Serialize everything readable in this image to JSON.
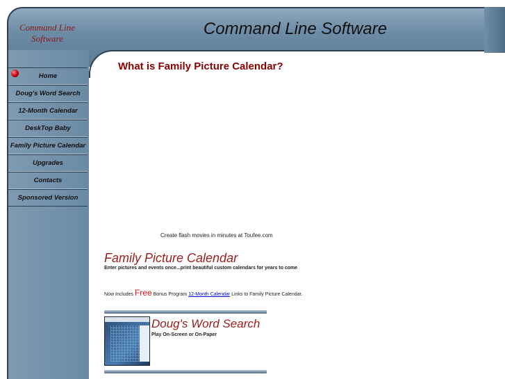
{
  "header": {
    "logo_line1": "Command Line",
    "logo_line2": "Software",
    "title": "Command Line Software"
  },
  "nav": {
    "items": [
      {
        "label": "Home"
      },
      {
        "label": "Doug's Word Search"
      },
      {
        "label": "12-Month Calendar"
      },
      {
        "label": "DeskTop Baby"
      },
      {
        "label": "Family Picture Calendar"
      },
      {
        "label": "Upgrades"
      },
      {
        "label": "Contacts"
      },
      {
        "label": "Sponsored Version"
      }
    ]
  },
  "main": {
    "heading": "What is  Family Picture Calendar?",
    "flash_caption": "Create flash movies in minutes at Toufee.com",
    "fpc_title": "Family Picture Calendar",
    "fpc_subtitle": "Enter pictures and events once...print beautiful custom calendars for years to come",
    "bonus_prefix": "Now Includes ",
    "bonus_free": "Free",
    "bonus_mid": " Bonus Program ",
    "bonus_link": "12-Month Calendar",
    "bonus_suffix": " Links to Family Picture Calendar.",
    "dws_title": "Doug's Word Search",
    "dws_subtitle": "Play On-Screen or On-Paper"
  },
  "colors": {
    "frame": "#6d8ca6",
    "accent_red": "#9b1c1c",
    "link": "#0000cc"
  }
}
